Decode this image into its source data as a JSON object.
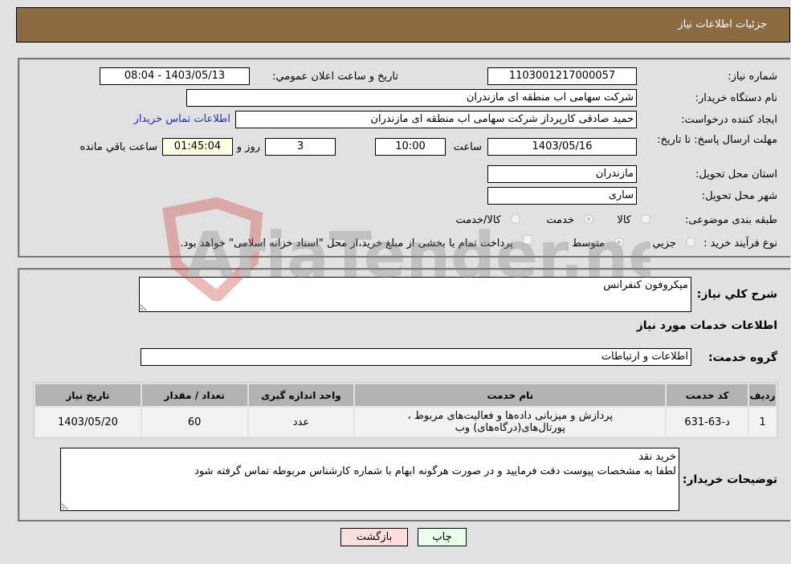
{
  "header": {
    "title": "جزئیات اطلاعات نیاز"
  },
  "details": {
    "need_number_label": "شماره نیاز:",
    "need_number": "1103001217000057",
    "announce_label": "تاریخ و ساعت اعلان عمومي:",
    "announce_value": "1403/05/13 - 08:04",
    "buyer_org_label": "نام دستگاه خريدار:",
    "buyer_org": "شرکت سهامی اب منطقه ای مازندران",
    "creator_label": "ايجاد كننده درخواست:",
    "creator": "حمید  صادقی کارپرداز شرکت سهامی اب منطقه ای مازندران",
    "contact_link": "اطلاعات تماس خريدار",
    "deadline_label": "مهلت ارسال پاسخ: تا تاريخ:",
    "deadline_date": "1403/05/16",
    "time_label": "ساعت",
    "deadline_time": "10:00",
    "days_value": "3",
    "days_label": "روز و",
    "remaining_time": "01:45:04",
    "remaining_label": "ساعت باقي مانده",
    "province_label": "استان محل تحويل:",
    "province": "مازندران",
    "city_label": "شهر محل تحويل:",
    "city": "ساری",
    "category_label": "طبقه بندی موضوعی:",
    "category_options": [
      "کالا",
      "خدمت",
      "کالا/خدمت"
    ],
    "category_selected": "خدمت",
    "process_label": "نوع فرآيند خريد :",
    "process_options": [
      "جزيي",
      "متوسط"
    ],
    "process_selected": "متوسط",
    "treasury_note": "پرداخت تمام يا بخشی از مبلغ خريد،از محل \"اسناد خزانه اسلامی\" خواهد بود."
  },
  "description": {
    "label": "شرح كلي نياز:",
    "value": "میکروفون کنفرانس"
  },
  "services": {
    "section_title": "اطلاعات خدمات مورد نياز",
    "group_label": "گروه خدمت:",
    "group_value": "اطلاعات و ارتباطات",
    "columns": [
      "رديف",
      "كد خدمت",
      "نام خدمت",
      "واحد اندازه گيری",
      "تعداد / مقدار",
      "تاريخ نياز"
    ],
    "rows": [
      {
        "index": "1",
        "code": "د-63-631",
        "name_line1": "پردازش و میزبانی داده‌ها و فعالیت‌های مربوط ،",
        "name_line2": "پورتال‌های(درگاه‌های) وب",
        "unit": "عدد",
        "quantity": "60",
        "date": "1403/05/20"
      }
    ]
  },
  "buyer_notes": {
    "label": "توضيحات خريدار:",
    "value": "خرید نقد\nلطفا به مشخصات پیوست دقت فرمایید و در صورت هرگونه ابهام با شماره کارشناس مربوطه تماس گرفته شود"
  },
  "buttons": {
    "print": "چاپ",
    "back": "بازگشت",
    "print_color": "#eaffea",
    "back_color": "#ffdede"
  },
  "watermark": {
    "text": "AriaTender.neT"
  }
}
